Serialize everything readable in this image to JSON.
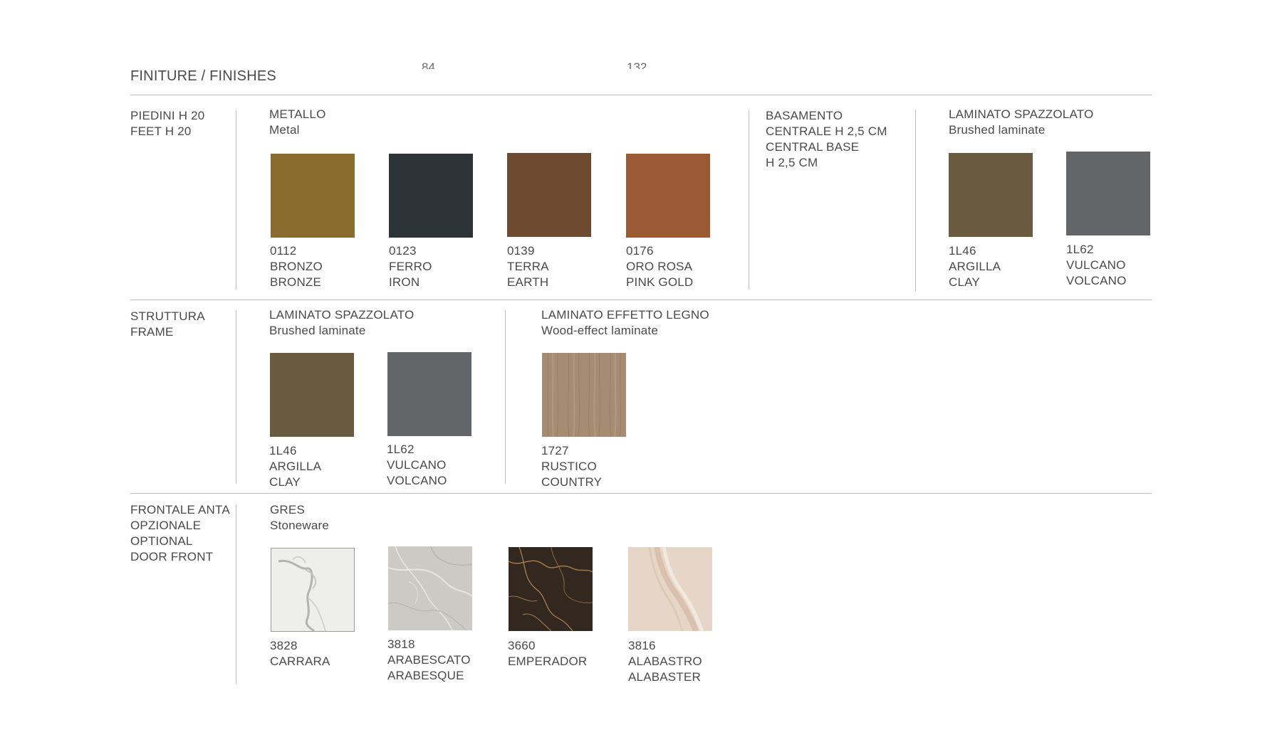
{
  "page": {
    "title": "FINITURE / FINISHES",
    "cut_fragments": [
      "84",
      "132"
    ]
  },
  "rows": {
    "feet": {
      "label": [
        "PIEDINI H 20",
        "FEET H 20"
      ],
      "metal": {
        "heading": "METALLO",
        "subheading": "Metal",
        "swatches": [
          {
            "code": "0112",
            "name_it": "BRONZO",
            "name_en": "BRONZE",
            "color": "#8b6c30"
          },
          {
            "code": "0123",
            "name_it": "FERRO",
            "name_en": "IRON",
            "color": "#2d3437"
          },
          {
            "code": "0139",
            "name_it": "TERRA",
            "name_en": "EARTH",
            "color": "#6e4b30"
          },
          {
            "code": "0176",
            "name_it": "ORO ROSA",
            "name_en": "PINK GOLD",
            "color": "#995a34"
          }
        ]
      },
      "base": {
        "heading": [
          "BASAMENTO",
          "CENTRALE H 2,5 CM",
          "CENTRAL BASE",
          "H 2,5 CM"
        ]
      },
      "laminate": {
        "heading": "LAMINATO SPAZZOLATO",
        "subheading": "Brushed laminate",
        "swatches": [
          {
            "code": "1L46",
            "name_it": "ARGILLA",
            "name_en": "CLAY",
            "color": "#6a5a40"
          },
          {
            "code": "1L62",
            "name_it": "VULCANO",
            "name_en": "VOLCANO",
            "color": "#636668"
          }
        ]
      }
    },
    "frame": {
      "label": [
        "STRUTTURA",
        "FRAME"
      ],
      "laminate": {
        "heading": "LAMINATO SPAZZOLATO",
        "subheading": "Brushed laminate",
        "swatches": [
          {
            "code": "1L46",
            "name_it": "ARGILLA",
            "name_en": "CLAY",
            "color": "#6a5a40"
          },
          {
            "code": "1L62",
            "name_it": "VULCANO",
            "name_en": "VOLCANO",
            "color": "#636668"
          }
        ]
      },
      "wood": {
        "heading": "LAMINATO EFFETTO LEGNO",
        "subheading": "Wood-effect laminate",
        "swatches": [
          {
            "code": "1727",
            "name_it": "RUSTICO",
            "name_en": "COUNTRY",
            "color": "#a58c72"
          }
        ]
      }
    },
    "door": {
      "label": [
        "FRONTALE ANTA",
        "OPZIONALE",
        "OPTIONAL",
        "DOOR FRONT"
      ],
      "stoneware": {
        "heading": "GRES",
        "subheading": "Stoneware",
        "swatches": [
          {
            "code": "3828",
            "name_it": "CARRARA",
            "name_en": "",
            "color": "#eeeeec"
          },
          {
            "code": "3818",
            "name_it": "ARABESCATO",
            "name_en": "ARABESQUE",
            "color": "#cbcac4"
          },
          {
            "code": "3660",
            "name_it": "EMPERADOR",
            "name_en": "",
            "color": "#33281f"
          },
          {
            "code": "3816",
            "name_it": "ALABASTRO",
            "name_en": "ALABASTER",
            "color": "#e6d6c8"
          }
        ]
      }
    }
  }
}
